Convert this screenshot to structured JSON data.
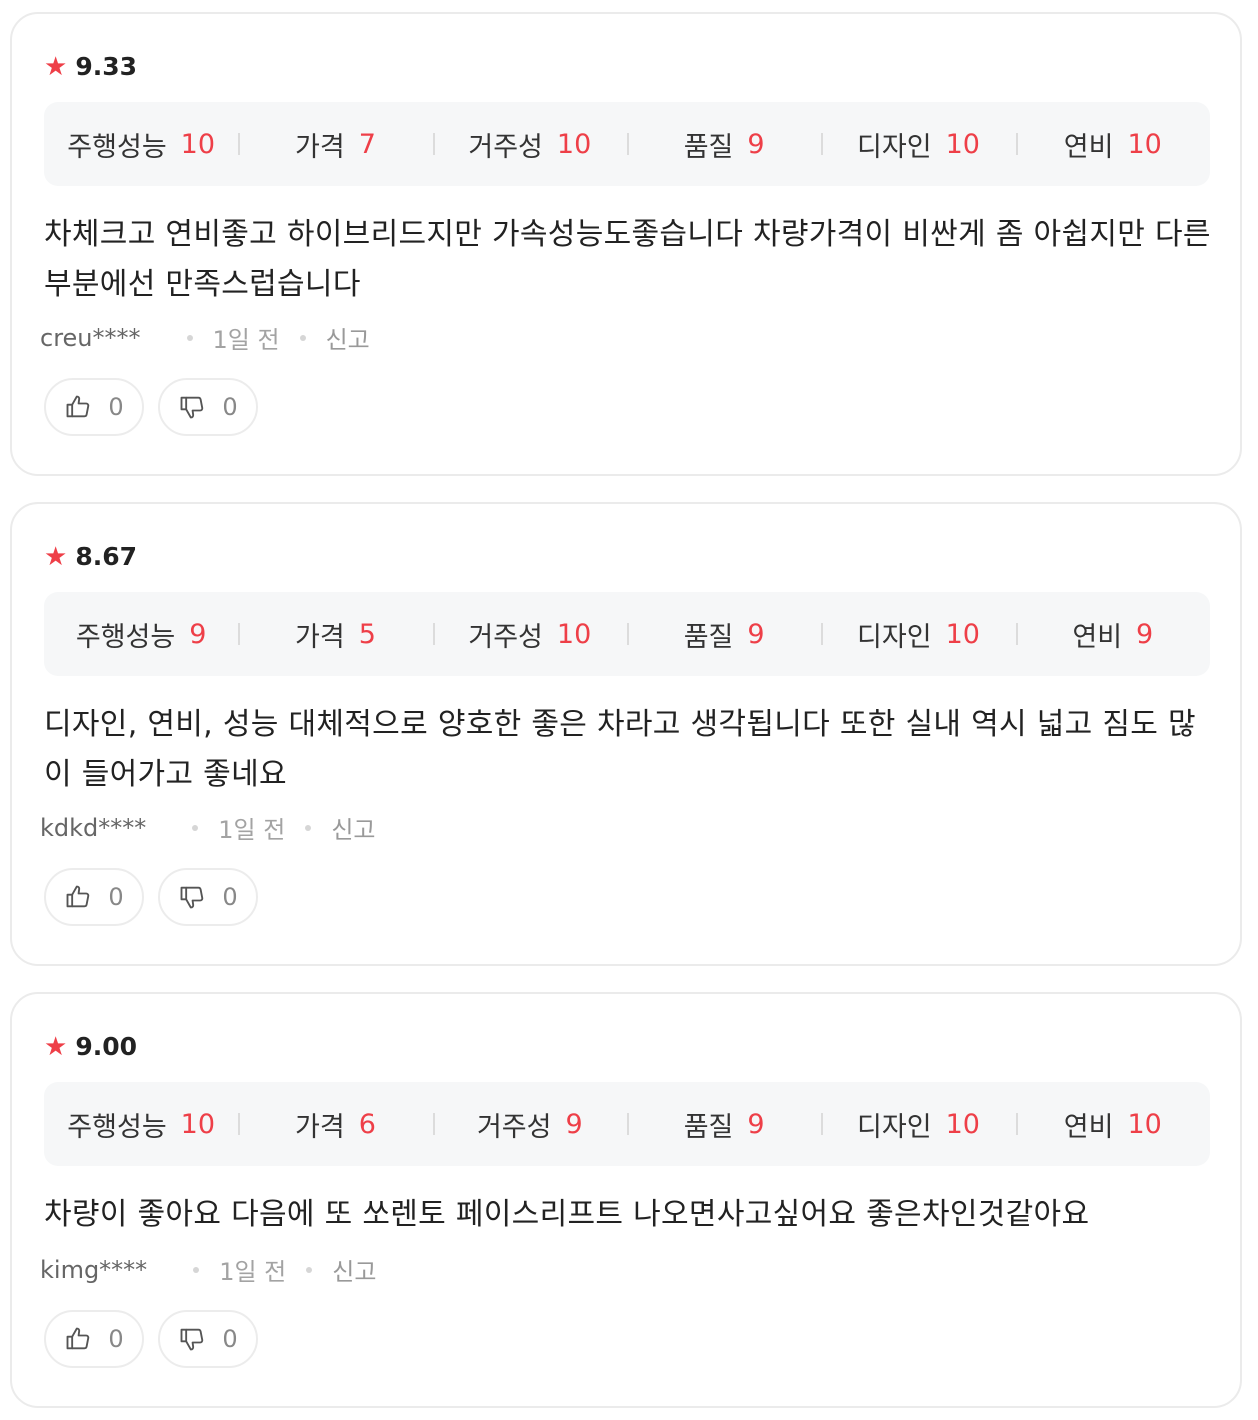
{
  "reviews": [
    {
      "rating": "9.33",
      "scores": [
        {
          "label": "주행성능",
          "value": "10"
        },
        {
          "label": "가격",
          "value": "7"
        },
        {
          "label": "거주성",
          "value": "10"
        },
        {
          "label": "품질",
          "value": "9"
        },
        {
          "label": "디자인",
          "value": "10"
        },
        {
          "label": "연비",
          "value": "10"
        }
      ],
      "text": "차체크고 연비좋고 하이브리드지만 가속성능도좋습니다 차량가격이 비싼게 좀 아쉽지만 다른부분에선 만족스럽습니다",
      "author": "creu****",
      "time": "1일 전",
      "report": "신고",
      "likes": "0",
      "dislikes": "0"
    },
    {
      "rating": "8.67",
      "scores": [
        {
          "label": "주행성능",
          "value": "9"
        },
        {
          "label": "가격",
          "value": "5"
        },
        {
          "label": "거주성",
          "value": "10"
        },
        {
          "label": "품질",
          "value": "9"
        },
        {
          "label": "디자인",
          "value": "10"
        },
        {
          "label": "연비",
          "value": "9"
        }
      ],
      "text": "디자인, 연비, 성능 대체적으로 양호한 좋은 차라고 생각됩니다 또한 실내 역시 넓고 짐도 많이 들어가고 좋네요",
      "author": "kdkd****",
      "time": "1일 전",
      "report": "신고",
      "likes": "0",
      "dislikes": "0"
    },
    {
      "rating": "9.00",
      "scores": [
        {
          "label": "주행성능",
          "value": "10"
        },
        {
          "label": "가격",
          "value": "6"
        },
        {
          "label": "거주성",
          "value": "9"
        },
        {
          "label": "품질",
          "value": "9"
        },
        {
          "label": "디자인",
          "value": "10"
        },
        {
          "label": "연비",
          "value": "10"
        }
      ],
      "text": "차량이 좋아요 다음에 또 쏘렌토 페이스리프트 나오면사고싶어요 좋은차인것같아요",
      "author": "kimg****",
      "time": "1일 전",
      "report": "신고",
      "likes": "0",
      "dislikes": "0"
    }
  ],
  "icons": {
    "star": "star-icon",
    "like": "thumbs-up-icon",
    "dislike": "thumbs-down-icon"
  },
  "colors": {
    "accent": "#ee3f48",
    "score_bg": "#f6f7f8",
    "card_border": "#ebebeb"
  }
}
